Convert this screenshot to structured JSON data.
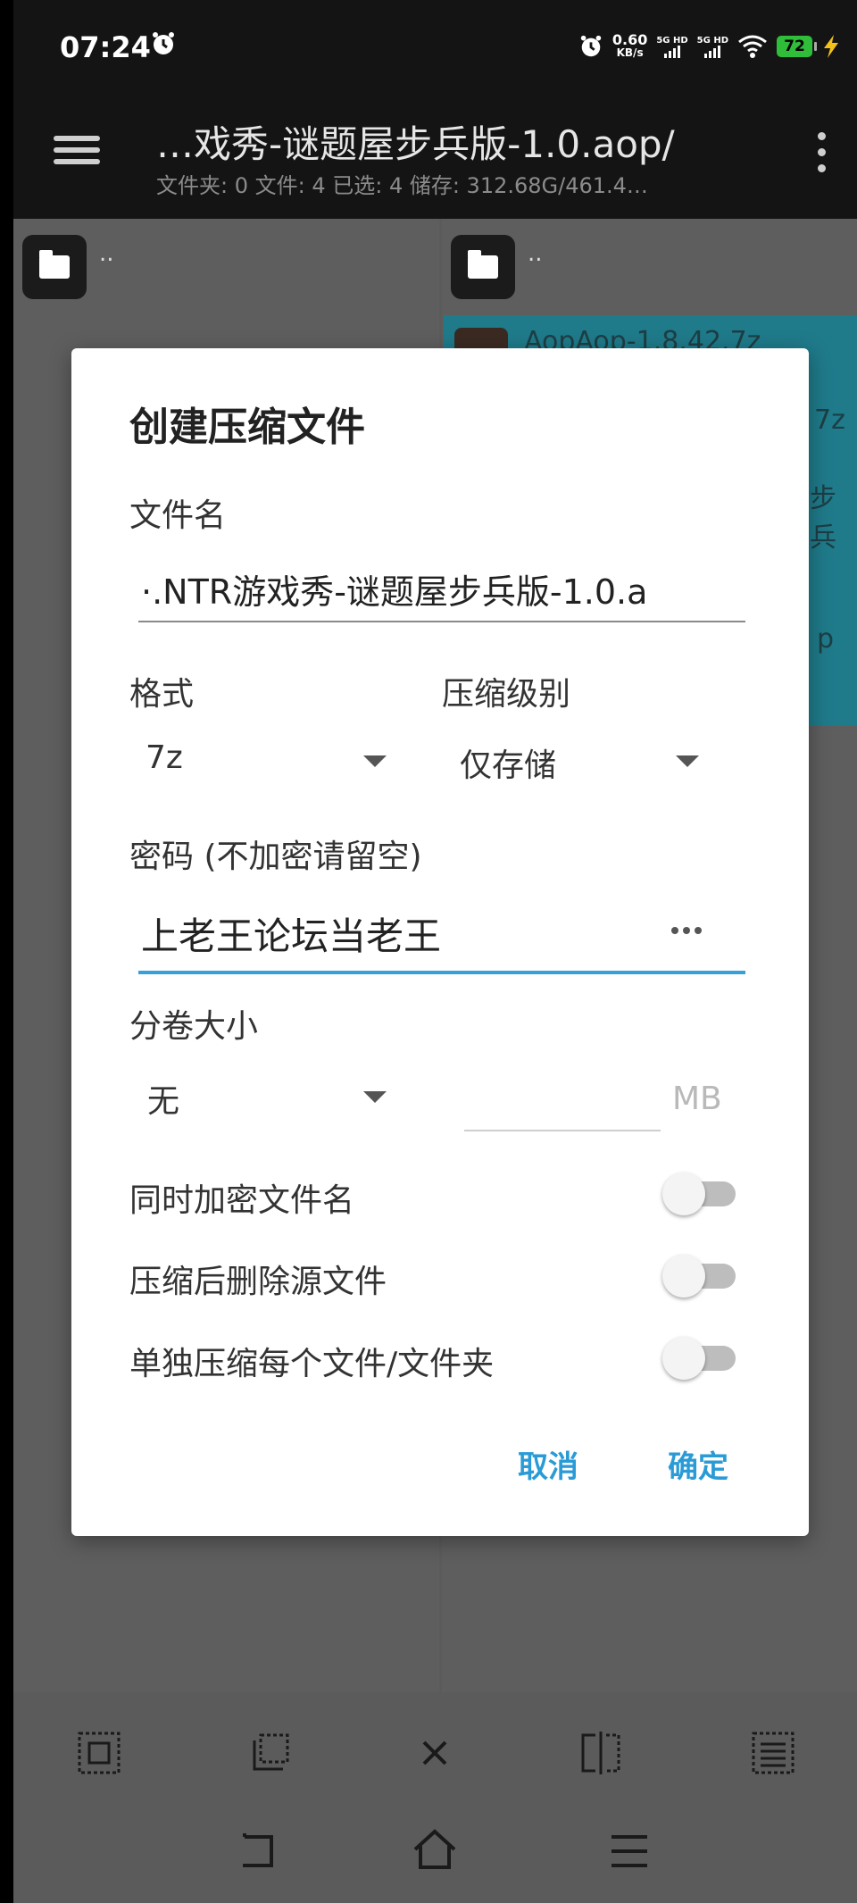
{
  "status_bar": {
    "time": "07:24",
    "net_speed_value": "0.60",
    "net_speed_unit": "KB/s",
    "sim1_label": "5G HD",
    "sim2_label": "5G HD",
    "battery": "72"
  },
  "app_bar": {
    "title": "…戏秀-谜题屋步兵版-1.0.aop/",
    "subtitle": "文件夹: 0  文件: 4  已选: 4  储存: 312.68G/461.4…"
  },
  "panes": {
    "left_parent": "..",
    "right_parent": "..",
    "right_ghost_1": "AopAop-1.8.42.7z",
    "right_ghost_2": "7z",
    "right_ghost_3": "步兵",
    "right_ghost_4": "p"
  },
  "dialog": {
    "title": "创建压缩文件",
    "filename_label": "文件名",
    "filename_value": "·.NTR游戏秀-谜题屋步兵版-1.0.a",
    "format_label": "格式",
    "format_value": "7z",
    "level_label": "压缩级别",
    "level_value": "仅存储",
    "password_label": "密码 (不加密请留空)",
    "password_value": "上老王论坛当老王",
    "split_label": "分卷大小",
    "split_value": "无",
    "split_unit": "MB",
    "options": [
      {
        "label": "同时加密文件名",
        "on": false
      },
      {
        "label": "压缩后删除源文件",
        "on": false
      },
      {
        "label": "单独压缩每个文件/文件夹",
        "on": false
      }
    ],
    "cancel_label": "取消",
    "ok_label": "确定"
  },
  "colors": {
    "accent": "#2a9bd6",
    "selection": "#1f7a8a",
    "battery": "#2fbd3a"
  },
  "icons": {
    "toolbar": [
      "select-all-icon",
      "select-range-icon",
      "clear-selection-icon",
      "invert-selection-icon",
      "list-icon"
    ],
    "nav": [
      "back-icon",
      "home-icon",
      "recents-icon"
    ]
  }
}
